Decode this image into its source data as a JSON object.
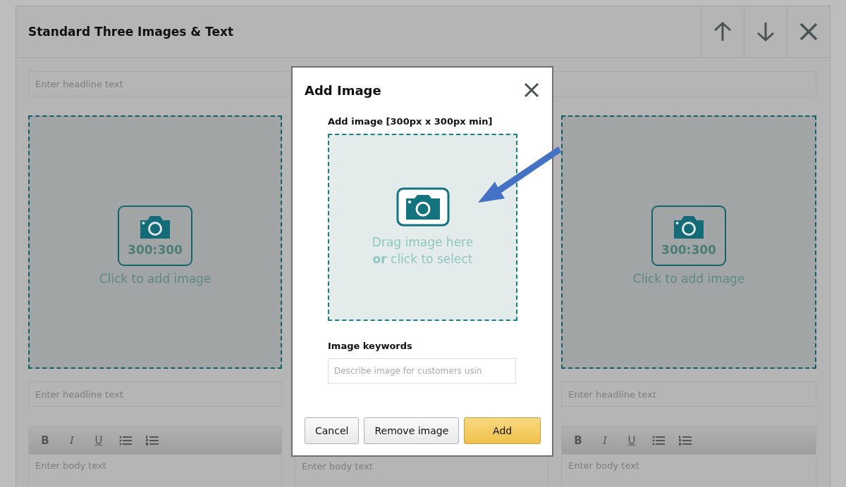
{
  "panel": {
    "title": "Standard Three Images & Text",
    "controls": [
      {
        "kind": "up"
      },
      {
        "kind": "down"
      },
      {
        "kind": "close"
      }
    ]
  },
  "headline": {
    "placeholder": "Enter headline text"
  },
  "columns": [
    {
      "image": {
        "ratio": "300:300",
        "caption": "Click to add image"
      },
      "headline": {
        "placeholder": "Enter headline text"
      },
      "toolbar": [
        {
          "kind": "bold",
          "label": "B"
        },
        {
          "kind": "italic",
          "label": "I"
        },
        {
          "kind": "underline",
          "label": "U"
        },
        {
          "kind": "bullets"
        },
        {
          "kind": "numbers"
        }
      ],
      "body": {
        "placeholder": "Enter body text"
      }
    },
    {
      "body": {
        "placeholder": "Enter body text"
      }
    },
    {
      "image": {
        "ratio": "300:300",
        "caption": "Click to add image"
      },
      "headline": {
        "placeholder": "Enter headline text"
      },
      "toolbar": [
        {
          "kind": "bold",
          "label": "B"
        },
        {
          "kind": "italic",
          "label": "I"
        },
        {
          "kind": "underline",
          "label": "U"
        },
        {
          "kind": "bullets"
        },
        {
          "kind": "numbers"
        }
      ],
      "body": {
        "placeholder": "Enter body text"
      }
    }
  ],
  "modal": {
    "title": "Add Image",
    "image_label": "Add image [300px x 300px min]",
    "drop_text": "Drag image here **or** click to select",
    "keywords_label": "Image keywords",
    "keywords_placeholder": "Describe image for customers usin",
    "buttons": [
      {
        "label": "Cancel",
        "kind": "secondary"
      },
      {
        "label": "Remove image",
        "kind": "secondary"
      },
      {
        "label": "Add",
        "kind": "primary"
      }
    ]
  }
}
